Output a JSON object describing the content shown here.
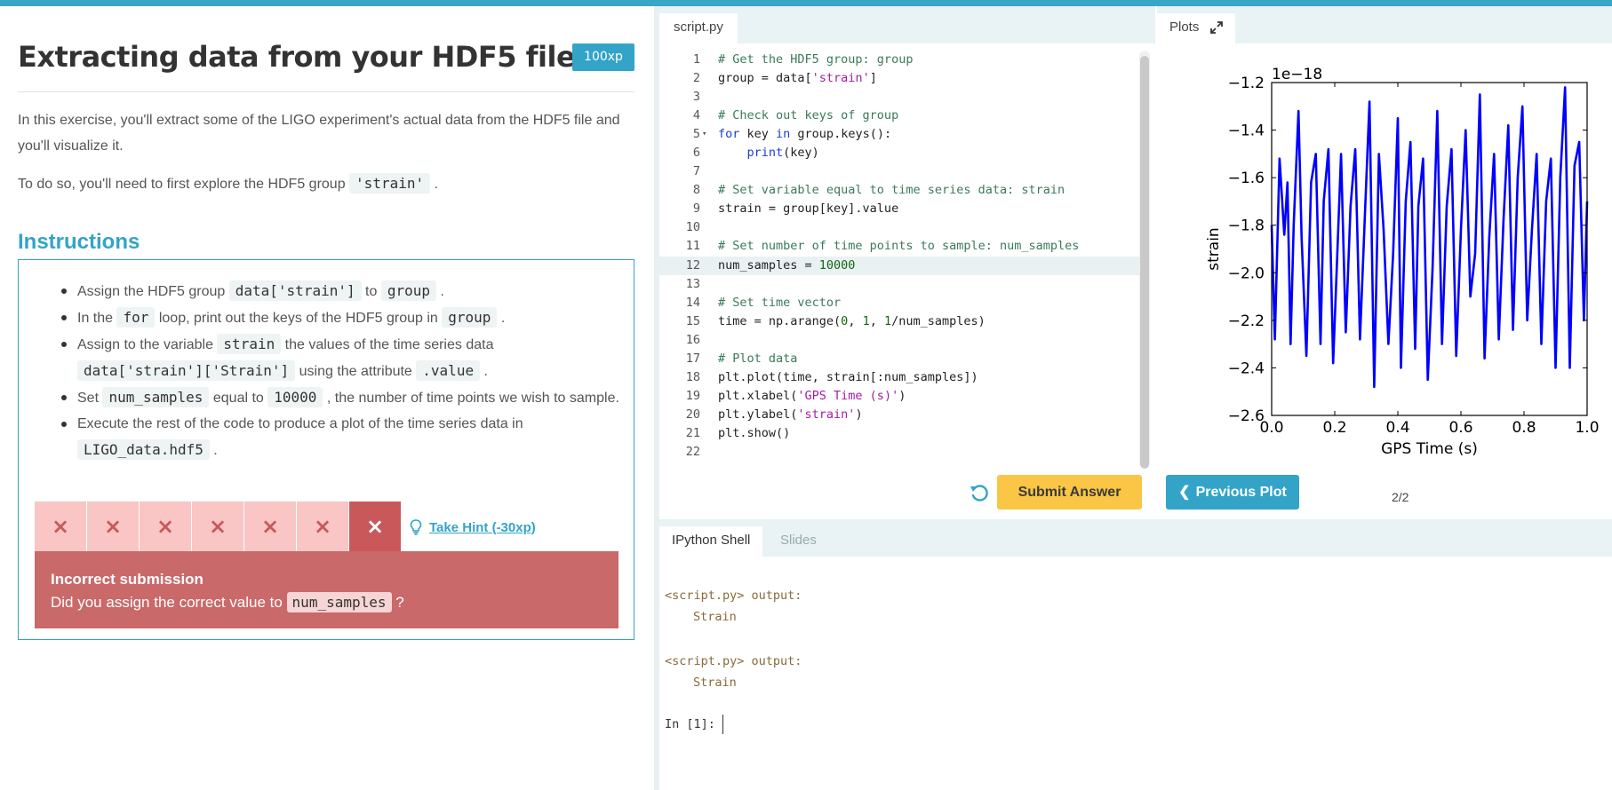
{
  "exercise": {
    "title": "Extracting data from your HDF5 file",
    "xp": "100xp",
    "para1": "In this exercise, you'll extract some of the LIGO experiment's actual data from the HDF5 file and you'll visualize it.",
    "para2_pre": "To do so, you'll need to first explore the HDF5 group",
    "para2_code": "'strain'",
    "para2_post": ".",
    "instructions_heading": "Instructions",
    "instructions": [
      {
        "parts": [
          "Assign the HDF5 group ",
          {
            "code": "data['strain']"
          },
          " to ",
          {
            "code": "group"
          },
          " ."
        ]
      },
      {
        "parts": [
          "In the ",
          {
            "code": "for"
          },
          " loop, print out the keys of the HDF5 group in ",
          {
            "code": "group"
          },
          " ."
        ]
      },
      {
        "parts": [
          "Assign to the variable ",
          {
            "code": "strain"
          },
          " the values of the time series data ",
          {
            "code": "data['strain']['Strain']"
          },
          " using the attribute ",
          {
            "code": ".value"
          },
          " ."
        ]
      },
      {
        "parts": [
          "Set ",
          {
            "code": "num_samples"
          },
          " equal to ",
          {
            "code": "10000"
          },
          " , the number of time points we wish to sample."
        ]
      },
      {
        "parts": [
          "Execute the rest of the code to produce a plot of the time series data in ",
          {
            "code": "LIGO_data.hdf5"
          },
          " ."
        ]
      }
    ],
    "attempts": [
      "×",
      "×",
      "×",
      "×",
      "×",
      "×",
      "×"
    ],
    "hint_label": "Take Hint (-30xp)",
    "feedback_title": "Incorrect submission",
    "feedback_pre": "Did you assign the correct value to",
    "feedback_code": "num_samples",
    "feedback_post": "?"
  },
  "editor": {
    "tab": "script.py",
    "lines": [
      {
        "n": "1",
        "t": "# Get the HDF5 group: group"
      },
      {
        "n": "2",
        "t": "group = data['strain']"
      },
      {
        "n": "3",
        "t": ""
      },
      {
        "n": "4",
        "t": "# Check out keys of group"
      },
      {
        "n": "5",
        "t": "for key in group.keys():",
        "fold": true
      },
      {
        "n": "6",
        "t": "    print(key)"
      },
      {
        "n": "7",
        "t": ""
      },
      {
        "n": "8",
        "t": "# Set variable equal to time series data: strain"
      },
      {
        "n": "9",
        "t": "strain = group[key].value"
      },
      {
        "n": "10",
        "t": ""
      },
      {
        "n": "11",
        "t": "# Set number of time points to sample: num_samples"
      },
      {
        "n": "12",
        "t": "num_samples = 10000",
        "active": true
      },
      {
        "n": "13",
        "t": ""
      },
      {
        "n": "14",
        "t": "# Set time vector"
      },
      {
        "n": "15",
        "t": "time = np.arange(0, 1, 1/num_samples)"
      },
      {
        "n": "16",
        "t": ""
      },
      {
        "n": "17",
        "t": "# Plot data"
      },
      {
        "n": "18",
        "t": "plt.plot(time, strain[:num_samples])"
      },
      {
        "n": "19",
        "t": "plt.xlabel('GPS Time (s)')"
      },
      {
        "n": "20",
        "t": "plt.ylabel('strain')"
      },
      {
        "n": "21",
        "t": "plt.show()"
      },
      {
        "n": "22",
        "t": ""
      }
    ],
    "submit_label": "Submit Answer"
  },
  "plots": {
    "tab": "Plots",
    "prev_label": "Previous Plot",
    "page_indicator": "2/2"
  },
  "chart_data": {
    "type": "line",
    "xlabel": "GPS Time (s)",
    "ylabel": "strain",
    "offset_label": "1e−18",
    "xlim": [
      0.0,
      1.0
    ],
    "ylim": [
      -2.6,
      -1.2
    ],
    "x_ticks": [
      "0.0",
      "0.2",
      "0.4",
      "0.6",
      "0.8",
      "1.0"
    ],
    "y_ticks": [
      "−1.2",
      "−1.4",
      "−1.6",
      "−1.8",
      "−2.0",
      "−2.2",
      "−2.4",
      "−2.6"
    ],
    "line_color": "#0000ff",
    "series": [
      {
        "x": [
          0.0,
          0.01,
          0.025,
          0.04,
          0.05,
          0.06,
          0.07,
          0.085,
          0.095,
          0.11,
          0.125,
          0.14,
          0.155,
          0.165,
          0.18,
          0.195,
          0.21,
          0.22,
          0.235,
          0.25,
          0.265,
          0.28,
          0.295,
          0.31,
          0.325,
          0.34,
          0.355,
          0.37,
          0.385,
          0.4,
          0.41,
          0.425,
          0.44,
          0.455,
          0.465,
          0.48,
          0.495,
          0.51,
          0.525,
          0.54,
          0.555,
          0.57,
          0.585,
          0.6,
          0.615,
          0.63,
          0.645,
          0.66,
          0.675,
          0.69,
          0.705,
          0.72,
          0.735,
          0.75,
          0.765,
          0.78,
          0.795,
          0.81,
          0.825,
          0.84,
          0.855,
          0.87,
          0.885,
          0.9,
          0.915,
          0.93,
          0.945,
          0.96,
          0.975,
          0.99,
          1.0
        ],
        "y": [
          -1.8,
          -2.28,
          -1.52,
          -1.84,
          -1.62,
          -2.3,
          -1.8,
          -1.32,
          -1.85,
          -2.35,
          -1.62,
          -1.5,
          -2.3,
          -1.7,
          -1.48,
          -2.38,
          -1.85,
          -1.5,
          -2.25,
          -1.72,
          -1.48,
          -2.28,
          -1.78,
          -1.28,
          -2.48,
          -1.5,
          -1.82,
          -2.3,
          -1.92,
          -1.35,
          -2.4,
          -1.7,
          -1.45,
          -2.32,
          -1.72,
          -1.52,
          -2.45,
          -1.98,
          -1.32,
          -2.3,
          -1.72,
          -1.48,
          -2.35,
          -1.82,
          -1.4,
          -2.1,
          -1.92,
          -1.25,
          -2.36,
          -1.85,
          -1.5,
          -2.28,
          -1.78,
          -1.38,
          -2.24,
          -1.6,
          -1.3,
          -2.2,
          -1.82,
          -1.5,
          -2.3,
          -1.7,
          -1.52,
          -2.4,
          -1.6,
          -1.22,
          -2.4,
          -1.55,
          -1.45,
          -2.2,
          -1.7
        ]
      }
    ]
  },
  "shell": {
    "tab_active": "IPython Shell",
    "tab_inactive": "Slides",
    "outputs": [
      {
        "label": "<script.py> output:",
        "value": "Strain"
      },
      {
        "label": "<script.py> output:",
        "value": "Strain"
      }
    ],
    "prompt": "In [1]:"
  }
}
